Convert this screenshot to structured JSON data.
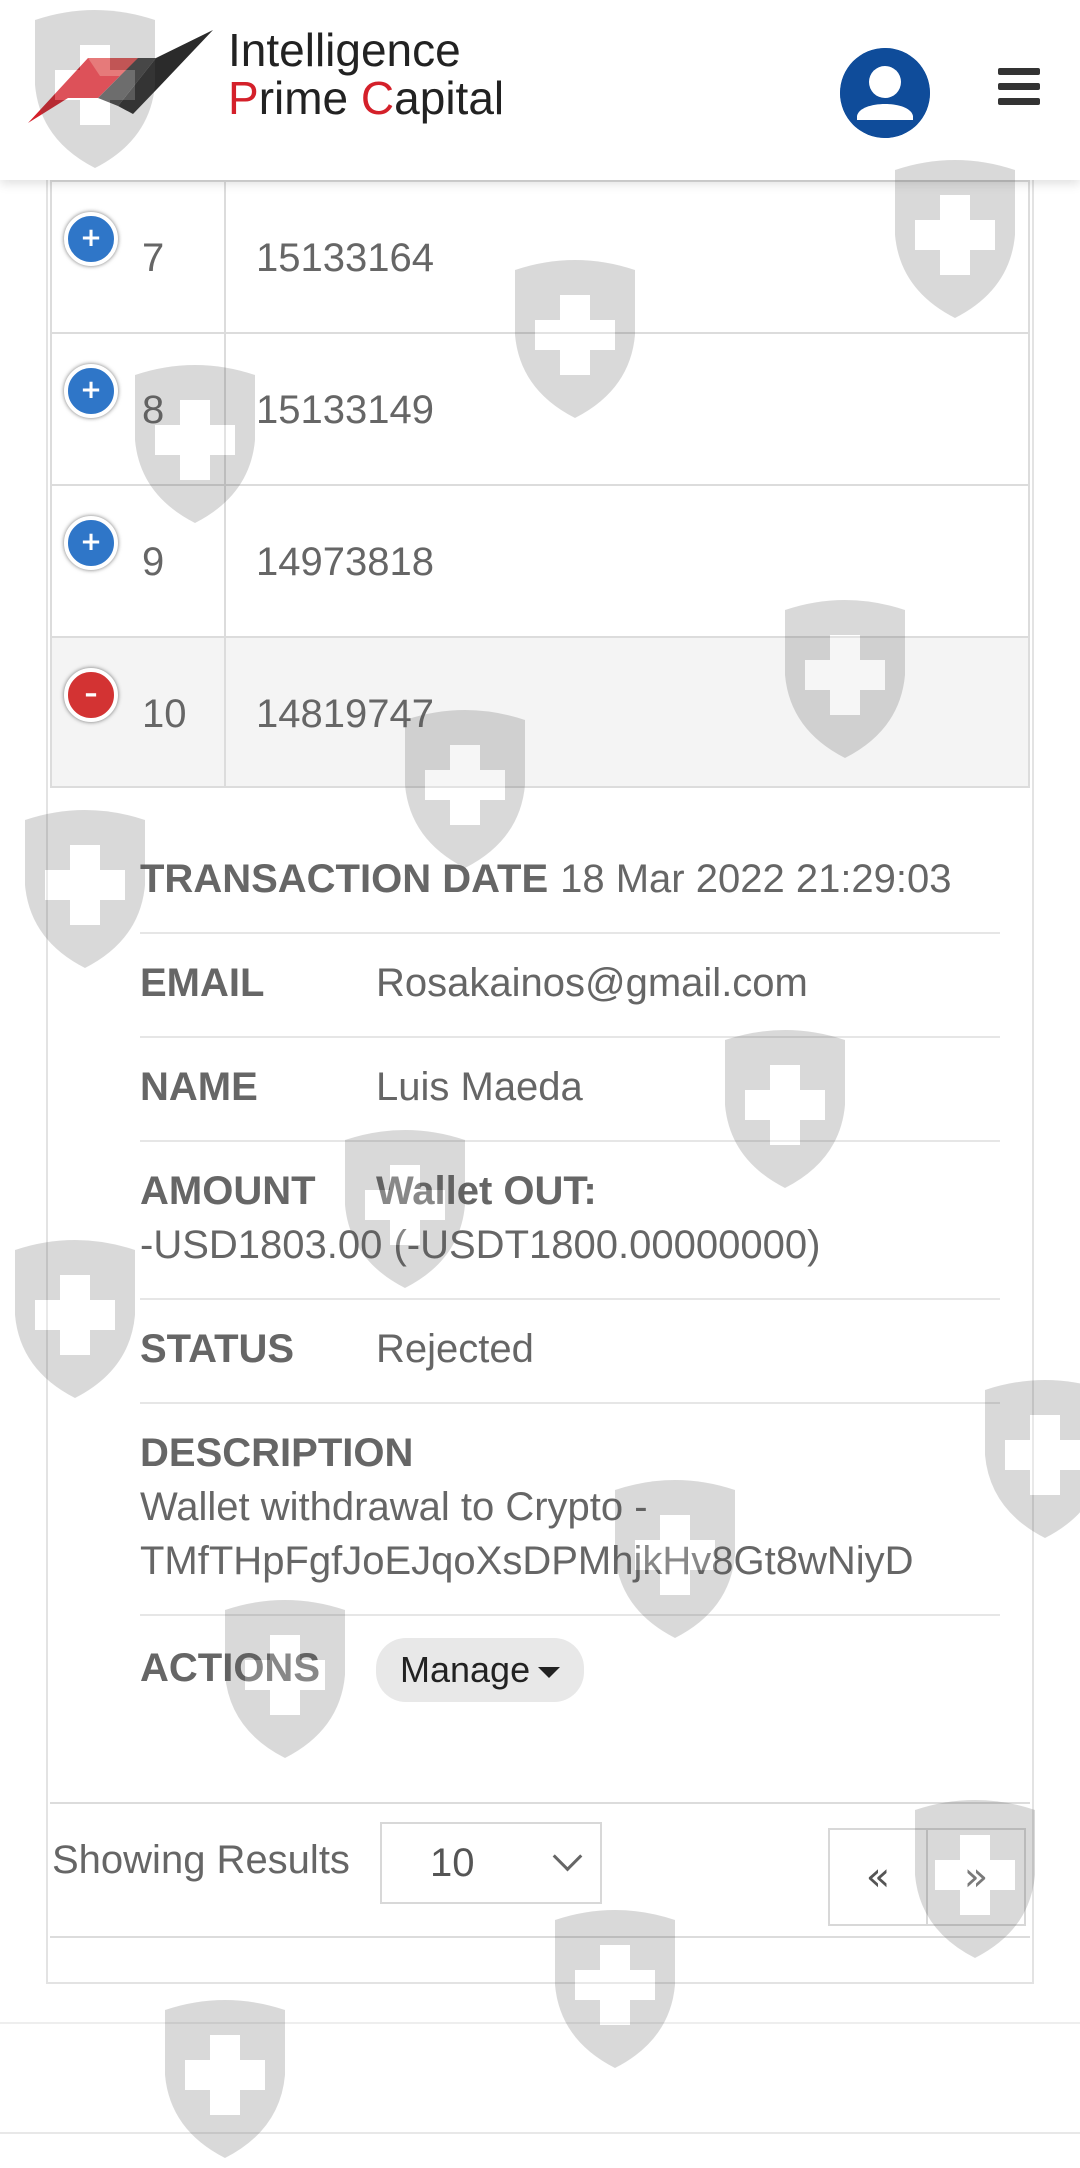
{
  "brand": {
    "line1": "Intelligence",
    "line2_p": "P",
    "line2_rime": "rime ",
    "line2_c": "C",
    "line2_apital": "apital"
  },
  "rows": [
    {
      "num": "7",
      "id": "15133164",
      "state": "collapsed"
    },
    {
      "num": "8",
      "id": "15133149",
      "state": "collapsed"
    },
    {
      "num": "9",
      "id": "14973818",
      "state": "collapsed"
    },
    {
      "num": "10",
      "id": "14819747",
      "state": "expanded"
    }
  ],
  "toggle": {
    "plus": "+",
    "minus": "–"
  },
  "detail": {
    "date_label": "TRANSACTION DATE",
    "date_value": "18 Mar 2022 21:29:03",
    "email_label": "EMAIL",
    "email_value": "Rosakainos@gmail.com",
    "name_label": "NAME",
    "name_value": "Luis Maeda",
    "amount_label": "AMOUNT",
    "amount_type": "Wallet OUT:",
    "amount_value": "-USD1803.00 (-USDT1800.00000000)",
    "status_label": "STATUS",
    "status_value": "Rejected",
    "description_label": "DESCRIPTION",
    "description_line1": "Wallet withdrawal to Crypto -",
    "description_line2": "TMfTHpFgfJoEJqoXsDPMhjkHv8Gt8wNiyD",
    "actions_label": "ACTIONS",
    "manage_label": "Manage"
  },
  "footer": {
    "showing_label": "Showing Results",
    "page_size": "10",
    "prev": "«",
    "next": "»"
  },
  "colors": {
    "brand_red": "#d4202a",
    "toggle_blue": "#2f76c8",
    "toggle_red": "#d33333",
    "avatar_blue": "#0f4c9a"
  },
  "icons": {
    "avatar": "user-avatar-icon",
    "menu": "hamburger-menu-icon",
    "watermark": "shield-cross-icon"
  }
}
